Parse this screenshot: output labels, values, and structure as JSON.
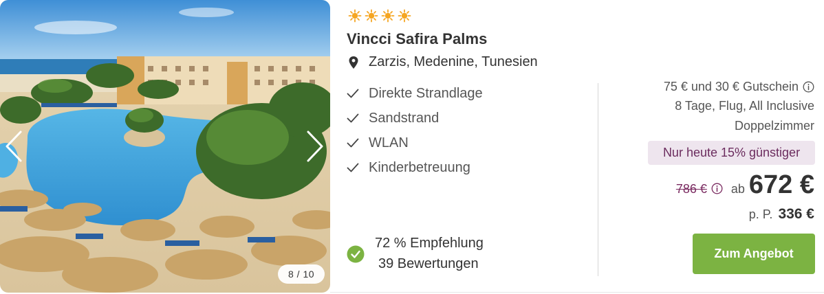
{
  "gallery": {
    "counter": "8 / 10",
    "prev_icon": "chevron-left-icon",
    "next_icon": "chevron-right-icon"
  },
  "hotel": {
    "star_count": 4,
    "star_color": "#f5a623",
    "name": "Vincci Safira Palms",
    "location": "Zarzis, Medenine, Tunesien",
    "features": [
      "Direkte Strandlage",
      "Sandstrand",
      "WLAN",
      "Kinderbetreuung"
    ]
  },
  "rating": {
    "recommendation": "72 % Empfehlung",
    "reviews": "39 Bewertungen",
    "badge_color": "#7cb342"
  },
  "offer": {
    "voucher": "75 € und 30 € Gutschein",
    "details": "8 Tage, Flug, All Inclusive",
    "room": "Doppelzimmer",
    "deal": "Nur heute 15% günstiger",
    "old_price": "786 €",
    "from": "ab",
    "price": "672 €",
    "per_person_label": "p. P.",
    "per_person_price": "336 €",
    "cta": "Zum Angebot",
    "cta_color": "#7cb342",
    "deal_color": "#6b2c5e"
  }
}
